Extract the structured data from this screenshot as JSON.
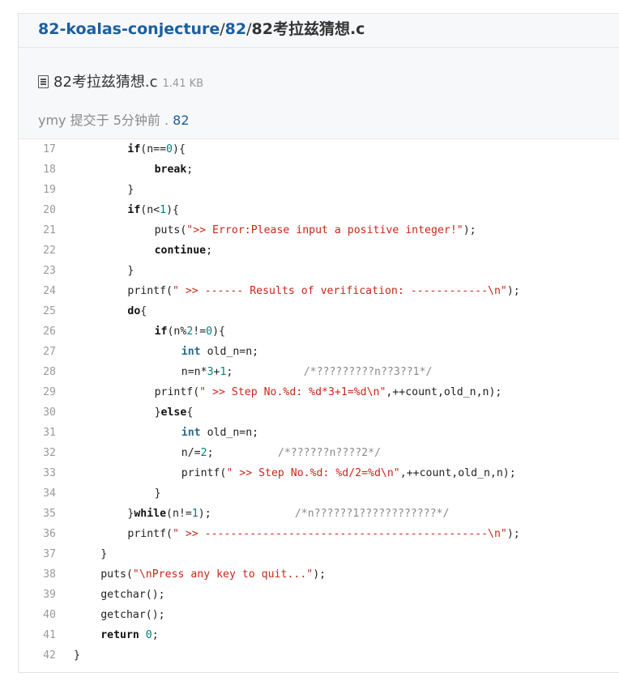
{
  "breadcrumb": {
    "repo": "82-koalas-conjecture",
    "sep1": "/",
    "folder": "82",
    "sep2": "/",
    "file": "82考拉兹猜想.c"
  },
  "file_header": {
    "icon": "document-icon",
    "name": "82考拉兹猜想.c",
    "size": "1.41 KB",
    "commit_prefix": "ymy 提交于 5分钟前 . ",
    "commit_link": "82"
  },
  "code": {
    "lines": [
      {
        "n": "17",
        "indent": 2,
        "tokens": [
          {
            "t": "kw",
            "v": "if"
          },
          {
            "t": "p",
            "v": "(n=="
          },
          {
            "t": "num",
            "v": "0"
          },
          {
            "t": "p",
            "v": "){"
          }
        ]
      },
      {
        "n": "18",
        "indent": 3,
        "tokens": [
          {
            "t": "kw",
            "v": "break"
          },
          {
            "t": "p",
            "v": ";"
          }
        ]
      },
      {
        "n": "19",
        "indent": 2,
        "tokens": [
          {
            "t": "p",
            "v": "}"
          }
        ]
      },
      {
        "n": "20",
        "indent": 2,
        "tokens": [
          {
            "t": "kw",
            "v": "if"
          },
          {
            "t": "p",
            "v": "(n<"
          },
          {
            "t": "num",
            "v": "1"
          },
          {
            "t": "p",
            "v": "){"
          }
        ]
      },
      {
        "n": "21",
        "indent": 3,
        "tokens": [
          {
            "t": "p",
            "v": "puts("
          },
          {
            "t": "str",
            "v": "\">> Error:Please input a positive integer!\""
          },
          {
            "t": "p",
            "v": ");"
          }
        ]
      },
      {
        "n": "22",
        "indent": 3,
        "tokens": [
          {
            "t": "kw",
            "v": "continue"
          },
          {
            "t": "p",
            "v": ";"
          }
        ]
      },
      {
        "n": "23",
        "indent": 2,
        "tokens": [
          {
            "t": "p",
            "v": "}"
          }
        ]
      },
      {
        "n": "24",
        "indent": 2,
        "tokens": [
          {
            "t": "p",
            "v": "printf("
          },
          {
            "t": "str",
            "v": "\" >> ------ Results of verification: ------------\\n\""
          },
          {
            "t": "p",
            "v": ");"
          }
        ]
      },
      {
        "n": "25",
        "indent": 2,
        "tokens": [
          {
            "t": "kw",
            "v": "do"
          },
          {
            "t": "p",
            "v": "{"
          }
        ]
      },
      {
        "n": "26",
        "indent": 3,
        "tokens": [
          {
            "t": "kw",
            "v": "if"
          },
          {
            "t": "p",
            "v": "(n%"
          },
          {
            "t": "num",
            "v": "2"
          },
          {
            "t": "p",
            "v": "!="
          },
          {
            "t": "num",
            "v": "0"
          },
          {
            "t": "p",
            "v": "){"
          }
        ]
      },
      {
        "n": "27",
        "indent": 4,
        "tokens": [
          {
            "t": "ty",
            "v": "int"
          },
          {
            "t": "p",
            "v": " old_n=n;"
          }
        ]
      },
      {
        "n": "28",
        "indent": 4,
        "tokens": [
          {
            "t": "p",
            "v": "n=n*"
          },
          {
            "t": "num",
            "v": "3"
          },
          {
            "t": "p",
            "v": "+"
          },
          {
            "t": "num",
            "v": "1"
          },
          {
            "t": "p",
            "v": ";           "
          },
          {
            "t": "cm",
            "v": "/*?????????n??3??1*/"
          }
        ]
      },
      {
        "n": "29",
        "indent": 3,
        "tokens": [
          {
            "t": "p",
            "v": "printf("
          },
          {
            "t": "str",
            "v": "\" >> Step No.%d: %d*3+1=%d\\n\""
          },
          {
            "t": "p",
            "v": ",++count,old_n,n);"
          }
        ]
      },
      {
        "n": "30",
        "indent": 3,
        "tokens": [
          {
            "t": "p",
            "v": "}"
          },
          {
            "t": "kw",
            "v": "else"
          },
          {
            "t": "p",
            "v": "{"
          }
        ]
      },
      {
        "n": "31",
        "indent": 4,
        "tokens": [
          {
            "t": "ty",
            "v": "int"
          },
          {
            "t": "p",
            "v": " old_n=n;"
          }
        ]
      },
      {
        "n": "32",
        "indent": 4,
        "tokens": [
          {
            "t": "p",
            "v": "n/="
          },
          {
            "t": "num",
            "v": "2"
          },
          {
            "t": "p",
            "v": ";          "
          },
          {
            "t": "cm",
            "v": "/*??????n????2*/"
          }
        ]
      },
      {
        "n": "33",
        "indent": 4,
        "tokens": [
          {
            "t": "p",
            "v": "printf("
          },
          {
            "t": "str",
            "v": "\" >> Step No.%d: %d/2=%d\\n\""
          },
          {
            "t": "p",
            "v": ",++count,old_n,n);"
          }
        ]
      },
      {
        "n": "34",
        "indent": 3,
        "tokens": [
          {
            "t": "p",
            "v": "}"
          }
        ]
      },
      {
        "n": "35",
        "indent": 2,
        "tokens": [
          {
            "t": "p",
            "v": "}"
          },
          {
            "t": "kw",
            "v": "while"
          },
          {
            "t": "p",
            "v": "(n!="
          },
          {
            "t": "num",
            "v": "1"
          },
          {
            "t": "p",
            "v": ");             "
          },
          {
            "t": "cm",
            "v": "/*n??????1????????????*/"
          }
        ]
      },
      {
        "n": "36",
        "indent": 2,
        "tokens": [
          {
            "t": "p",
            "v": "printf("
          },
          {
            "t": "str",
            "v": "\" >> --------------------------------------------\\n\""
          },
          {
            "t": "p",
            "v": ");"
          }
        ]
      },
      {
        "n": "37",
        "indent": 1,
        "tokens": [
          {
            "t": "p",
            "v": "}"
          }
        ]
      },
      {
        "n": "38",
        "indent": 1,
        "tokens": [
          {
            "t": "p",
            "v": "puts("
          },
          {
            "t": "str",
            "v": "\"\\nPress any key to quit...\""
          },
          {
            "t": "p",
            "v": ");"
          }
        ]
      },
      {
        "n": "39",
        "indent": 1,
        "tokens": [
          {
            "t": "p",
            "v": "getchar();"
          }
        ]
      },
      {
        "n": "40",
        "indent": 1,
        "tokens": [
          {
            "t": "p",
            "v": "getchar();"
          }
        ]
      },
      {
        "n": "41",
        "indent": 1,
        "tokens": [
          {
            "t": "kw",
            "v": "return"
          },
          {
            "t": "p",
            "v": " "
          },
          {
            "t": "num",
            "v": "0"
          },
          {
            "t": "p",
            "v": ";"
          }
        ]
      },
      {
        "n": "42",
        "indent": 0,
        "tokens": [
          {
            "t": "p",
            "v": "}"
          }
        ]
      }
    ]
  }
}
